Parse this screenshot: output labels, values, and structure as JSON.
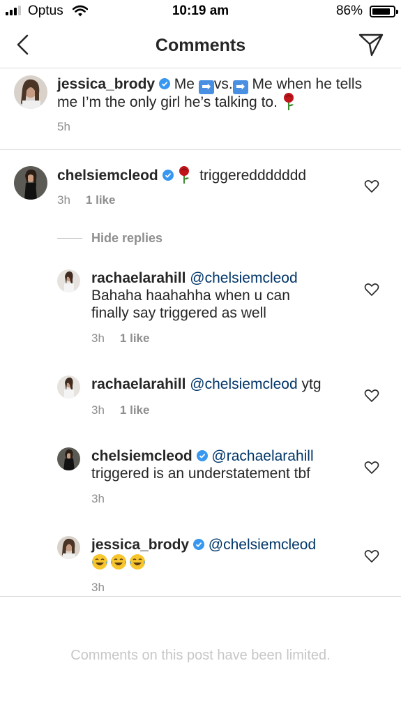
{
  "status_bar": {
    "carrier": "Optus",
    "time": "10:19 am",
    "battery": "86%",
    "battery_level": 0.86,
    "signal_bars": 3
  },
  "nav": {
    "title": "Comments",
    "back_icon": "chevron-left-icon",
    "send_icon": "paper-plane-icon"
  },
  "caption": {
    "username": "jessica_brody",
    "text_part1": "Me",
    "text_part2": "vs.",
    "text_part3": "Me when he tells",
    "text_line2": "me I’m the only girl he’s talking to.",
    "arrow_emoji": "➡",
    "time": "5h"
  },
  "comment": {
    "username": "chelsiemcleod",
    "text": "triggereddddddd",
    "time": "3h",
    "likes": "1 like",
    "hide_replies": "Hide replies"
  },
  "replies": [
    {
      "username": "rachaelarahill",
      "mention": "@chelsiemcleod",
      "line2": "Bahaha haahahha when u can",
      "line3": "finally say triggered as well",
      "time": "3h",
      "likes": "1 like"
    },
    {
      "username": "rachaelarahill",
      "mention": "@chelsiemcleod",
      "text": "ytg",
      "time": "3h",
      "likes": "1 like"
    },
    {
      "username": "chelsiemcleod",
      "mention": "@rachaelarahill",
      "line2": "triggered is an understatement tbf",
      "time": "3h"
    },
    {
      "username": "jessica_brody",
      "mention": "@chelsiemcleod",
      "time": "3h"
    }
  ],
  "footer": {
    "limited_text": "Comments on this post have been limited."
  },
  "colors": {
    "verified": "#3897f0",
    "mention": "#003569",
    "muted": "#8e8e8e",
    "divider": "#dbdbdb"
  }
}
